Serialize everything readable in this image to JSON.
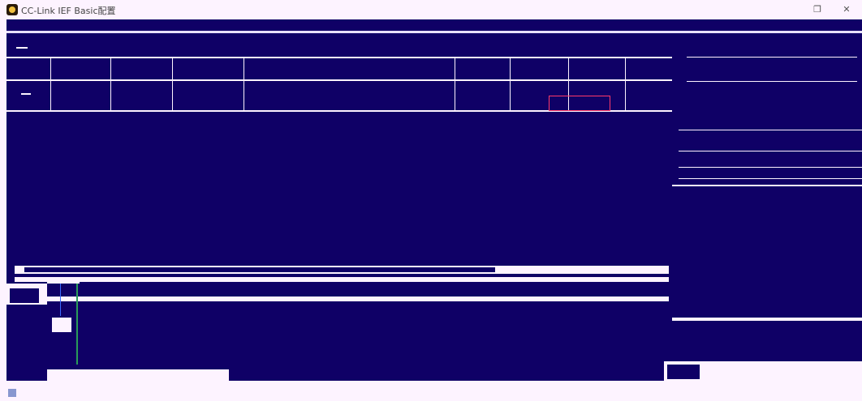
{
  "window": {
    "title": "CC-Link IEF Basic配置",
    "maximize_glyph": "❐",
    "close_glyph": "✕"
  },
  "icons": [
    "app-icon",
    "maximize-icon",
    "close-icon"
  ],
  "colors": {
    "background_dark": "#0f0066",
    "background_light": "#fdf3ff",
    "selection": "#ff3a6a"
  }
}
